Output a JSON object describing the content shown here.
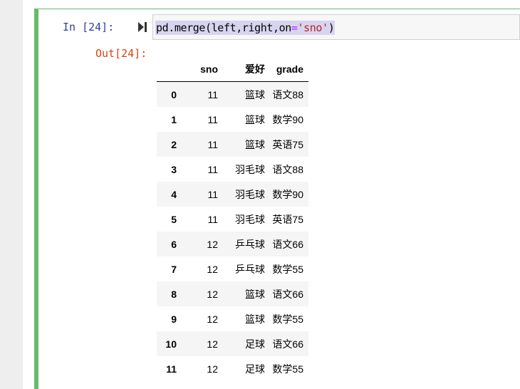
{
  "input_prompt": "In  [24]:",
  "code": {
    "prefix": "pd.merge(left,right,on",
    "operator": "=",
    "string": "'sno'",
    "suffix": ")"
  },
  "output_prompt": "Out[24]:",
  "table": {
    "columns": [
      "",
      "sno",
      "爱好",
      "grade"
    ],
    "rows": [
      {
        "index": "0",
        "sno": "11",
        "hobby": "篮球",
        "grade": "语文88"
      },
      {
        "index": "1",
        "sno": "11",
        "hobby": "篮球",
        "grade": "数学90"
      },
      {
        "index": "2",
        "sno": "11",
        "hobby": "篮球",
        "grade": "英语75"
      },
      {
        "index": "3",
        "sno": "11",
        "hobby": "羽毛球",
        "grade": "语文88"
      },
      {
        "index": "4",
        "sno": "11",
        "hobby": "羽毛球",
        "grade": "数学90"
      },
      {
        "index": "5",
        "sno": "11",
        "hobby": "羽毛球",
        "grade": "英语75"
      },
      {
        "index": "6",
        "sno": "12",
        "hobby": "乒乓球",
        "grade": "语文66"
      },
      {
        "index": "7",
        "sno": "12",
        "hobby": "乒乓球",
        "grade": "数学55"
      },
      {
        "index": "8",
        "sno": "12",
        "hobby": "篮球",
        "grade": "语文66"
      },
      {
        "index": "9",
        "sno": "12",
        "hobby": "篮球",
        "grade": "数学55"
      },
      {
        "index": "10",
        "sno": "12",
        "hobby": "足球",
        "grade": "语文66"
      },
      {
        "index": "11",
        "sno": "12",
        "hobby": "足球",
        "grade": "数学55"
      }
    ]
  },
  "colors": {
    "cell_selected_bar": "#66bb6a",
    "in_prompt": "#303f9f",
    "out_prompt": "#d84315",
    "code_selection": "#d7d4f0",
    "code_operator": "#aa22ff",
    "code_string": "#ba2121"
  },
  "icons": {
    "run": "step-forward-icon"
  }
}
